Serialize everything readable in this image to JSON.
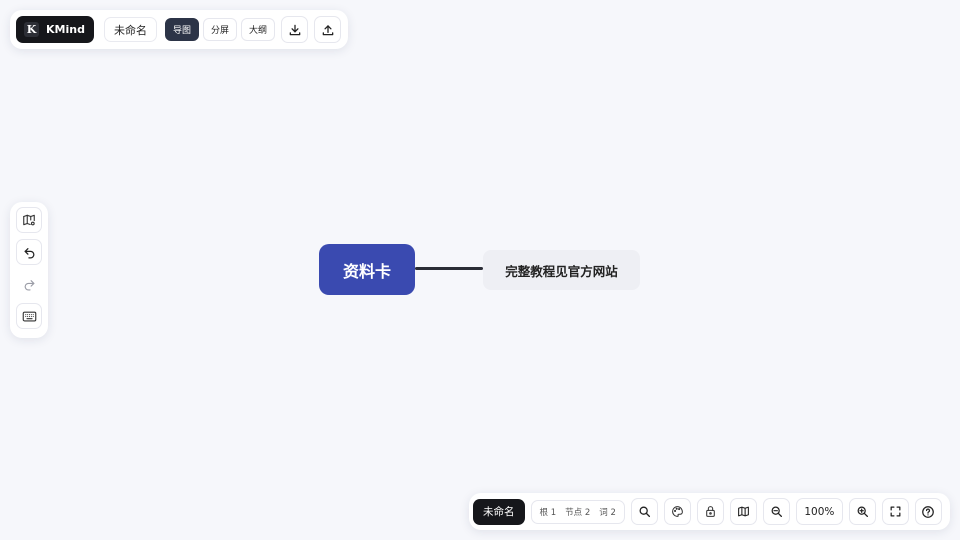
{
  "brand": {
    "name": "KMind",
    "logo_letter": "K"
  },
  "toolbar": {
    "doc_title": "未命名",
    "tabs": [
      {
        "label": "导图",
        "active": true
      },
      {
        "label": "分屏",
        "active": false
      },
      {
        "label": "大纲",
        "active": false
      }
    ],
    "icons": [
      "download-icon",
      "upload-icon"
    ]
  },
  "left_toolbar": {
    "icons": [
      "map-settings-icon",
      "undo-icon",
      "redo-icon",
      "keyboard-icon"
    ]
  },
  "mindmap": {
    "root": {
      "label": "资料卡"
    },
    "children": [
      {
        "label": "完整教程见官方网站"
      }
    ]
  },
  "bottom_toolbar": {
    "doc_name": "未命名",
    "stats": {
      "roots": "根 1",
      "nodes": "节点 2",
      "words": "词 2"
    },
    "zoom": "100%",
    "icons": [
      "search-icon",
      "theme-palette-icon",
      "lock-icon",
      "map-icon",
      "zoom-out-icon",
      "zoom-in-icon",
      "fullscreen-icon",
      "help-icon"
    ]
  },
  "colors": {
    "canvas_bg": "#f6f7fb",
    "root_node": "#3a4ab0",
    "child_node": "#eeeff4",
    "dark": "#16171b",
    "active_tab": "#2c3447"
  }
}
